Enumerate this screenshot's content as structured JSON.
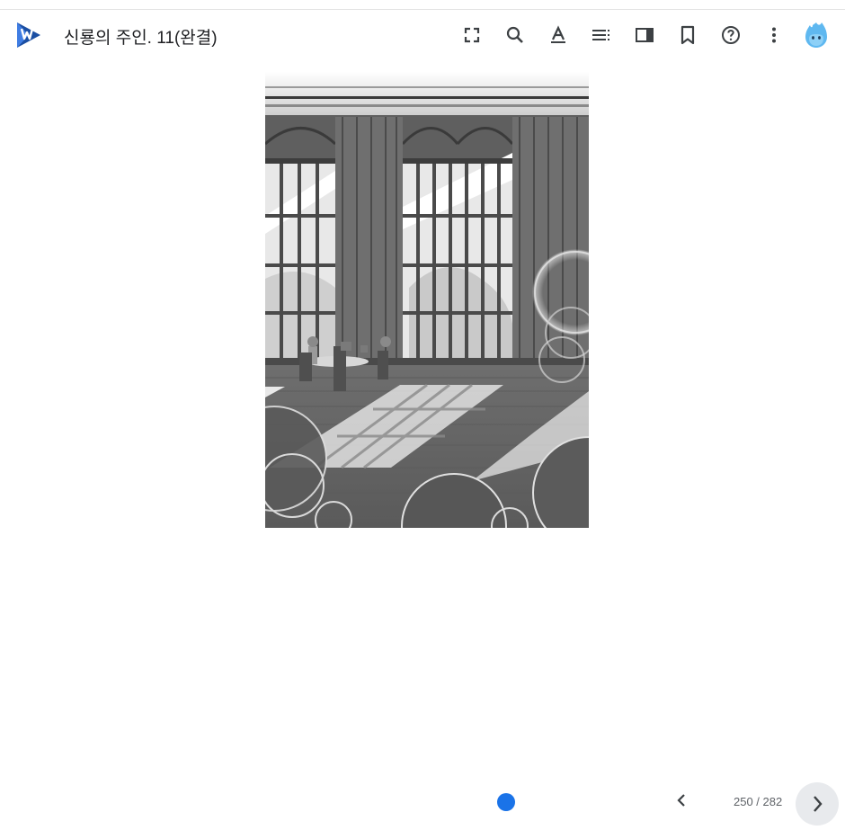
{
  "header": {
    "title": "신룡의 주인. 11(완결)",
    "icons": [
      "fullscreen-icon",
      "search-icon",
      "text-format-icon",
      "table-of-contents-icon",
      "side-panel-icon",
      "bookmark-icon",
      "help-icon",
      "more-vert-icon"
    ]
  },
  "colors": {
    "accent": "#1a73e8",
    "icon": "#5f6368",
    "logo_dark": "#1b3a7a",
    "logo_light": "#4285f4",
    "avatar": "#5fb8f0"
  },
  "footer": {
    "page_indicator": "250 / 282"
  }
}
